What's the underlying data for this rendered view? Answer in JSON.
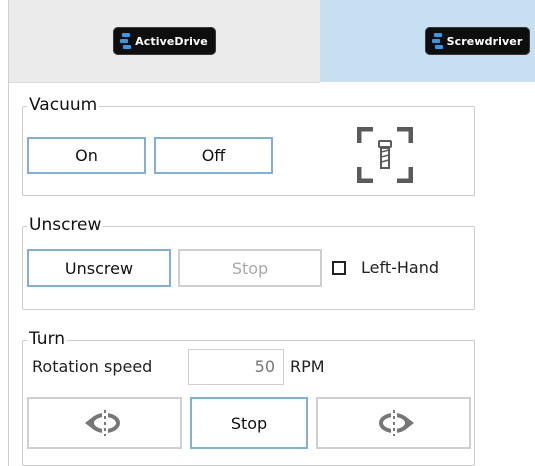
{
  "tabs": [
    {
      "label": "ActiveDrive",
      "active": false
    },
    {
      "label": "Screwdriver",
      "active": true
    }
  ],
  "vacuum": {
    "title": "Vacuum",
    "on_label": "On",
    "off_label": "Off",
    "icon": "screw-target-icon"
  },
  "unscrew": {
    "title": "Unscrew",
    "unscrew_label": "Unscrew",
    "stop_label": "Stop",
    "left_hand_label": "Left-Hand",
    "left_hand_checked": false
  },
  "turn": {
    "title": "Turn",
    "rotation_label": "Rotation speed",
    "rotation_value": "50",
    "rotation_unit": "RPM",
    "ccw_icon": "rotate-ccw-icon",
    "stop_label": "Stop",
    "cw_icon": "rotate-cw-icon"
  },
  "colors": {
    "active_tab": "#c6dff1",
    "inactive_tab": "#ebebeb",
    "button_border": "#7fb1d8",
    "disabled_border": "#cfcfcf"
  }
}
